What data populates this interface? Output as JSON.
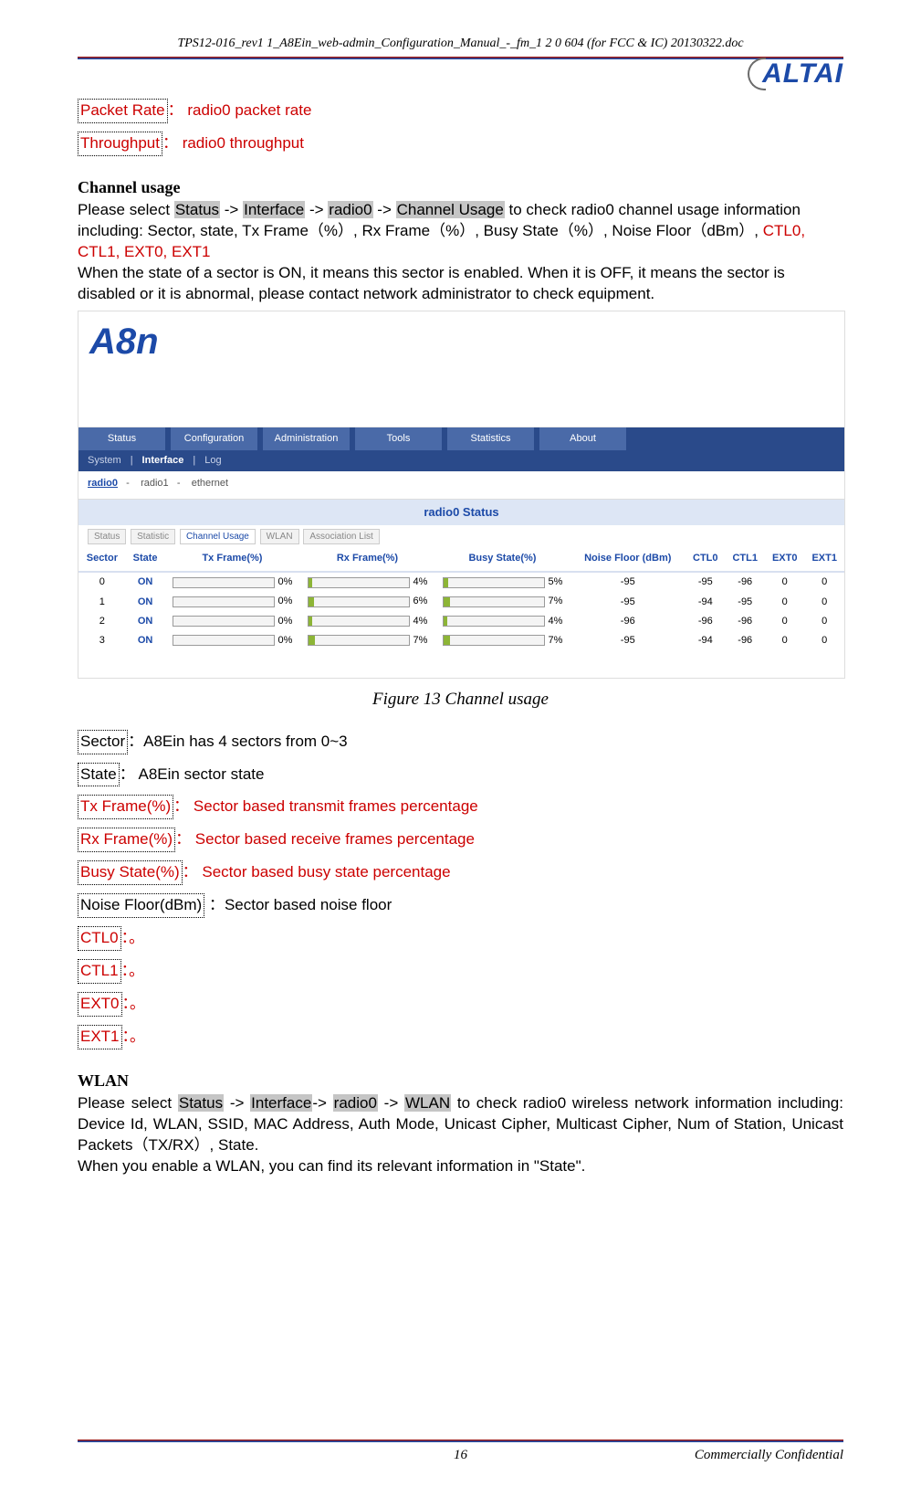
{
  "doc_header": "TPS12-016_rev1 1_A8Ein_web-admin_Configuration_Manual_-_fm_1 2 0 604 (for FCC & IC) 20130322.doc",
  "logo_text": "ALTAI",
  "top_defs": {
    "packet_rate_label": "Packet Rate",
    "packet_rate_desc": "radio0 packet rate",
    "throughput_label": "Throughput",
    "throughput_desc": "radio0 throughput"
  },
  "channel_usage": {
    "heading": "Channel usage",
    "p1_pre": "Please select ",
    "nav_status": "Status",
    "arrow": " -> ",
    "nav_interface": "Interface",
    "nav_radio0": "radio0",
    "nav_channel_usage": "Channel Usage",
    "p1_post": " to check radio0 channel usage information including: Sector, state, Tx Frame（%）, Rx Frame（%）, Busy State（%）, Noise Floor（dBm）, ",
    "p1_red": "CTL0, CTL1, EXT0, EXT1",
    "p2": "When the state of a sector is ON, it means this sector is enabled. When it is OFF, it means the sector is disabled or it is abnormal, please contact network administrator to check equipment."
  },
  "screenshot": {
    "brand": "A8n",
    "nav": [
      "Status",
      "Configuration",
      "Administration",
      "Tools",
      "Statistics",
      "About"
    ],
    "subnav": {
      "system": "System",
      "interface": "Interface",
      "log": "Log"
    },
    "iface": {
      "radio0": "radio0",
      "radio1": "radio1",
      "ethernet": "ethernet"
    },
    "title": "radio0 Status",
    "tabs": [
      "Status",
      "Statistic",
      "Channel Usage",
      "WLAN",
      "Association List"
    ],
    "headers": [
      "Sector",
      "State",
      "Tx Frame(%)",
      "Rx Frame(%)",
      "Busy State(%)",
      "Noise Floor (dBm)",
      "CTL0",
      "CTL1",
      "EXT0",
      "EXT1"
    ],
    "rows": [
      {
        "sector": "0",
        "state": "ON",
        "tx": "0%",
        "txv": 0,
        "rx": "4%",
        "rxv": 4,
        "busy": "5%",
        "busyv": 5,
        "nf": "-95",
        "c0": "-95",
        "c1": "-96",
        "e0": "0",
        "e1": "0"
      },
      {
        "sector": "1",
        "state": "ON",
        "tx": "0%",
        "txv": 0,
        "rx": "6%",
        "rxv": 6,
        "busy": "7%",
        "busyv": 7,
        "nf": "-95",
        "c0": "-94",
        "c1": "-95",
        "e0": "0",
        "e1": "0"
      },
      {
        "sector": "2",
        "state": "ON",
        "tx": "0%",
        "txv": 0,
        "rx": "4%",
        "rxv": 4,
        "busy": "4%",
        "busyv": 4,
        "nf": "-96",
        "c0": "-96",
        "c1": "-96",
        "e0": "0",
        "e1": "0"
      },
      {
        "sector": "3",
        "state": "ON",
        "tx": "0%",
        "txv": 0,
        "rx": "7%",
        "rxv": 7,
        "busy": "7%",
        "busyv": 7,
        "nf": "-95",
        "c0": "-94",
        "c1": "-96",
        "e0": "0",
        "e1": "0"
      }
    ]
  },
  "figure_caption": "Figure 13 Channel usage",
  "defs": {
    "sector_label": "Sector",
    "sector_desc": "A8Ein has 4 sectors from 0~3",
    "state_label": "State",
    "state_desc": " A8Ein sector state",
    "tx_label": "Tx Frame(%)",
    "tx_desc": " Sector based transmit frames percentage",
    "rx_label": "Rx Frame(%)",
    "rx_desc": " Sector based receive frames percentage",
    "busy_label": "Busy State(%)",
    "busy_desc": " Sector based busy state percentage",
    "nf_label": "Noise Floor(dBm)",
    "nf_desc": "Sector based noise floor",
    "ctl0_label": "CTL0",
    "ctl1_label": "CTL1",
    "ext0_label": "EXT0",
    "ext1_label": "EXT1",
    "dot": "。"
  },
  "wlan": {
    "heading": "WLAN",
    "p1_pre": "Please  select  ",
    "nav_status": "Status",
    "arrow": "  ->  ",
    "nav_interface": "Interface",
    "nav_radio0": "radio0",
    "nav_wlan": "WLAN",
    "p1_post": "  to  check  radio0  wireless  network  information including: Device Id, WLAN, SSID, MAC Address, Auth Mode, Unicast Cipher, Multicast Cipher, Num of Station, Unicast Packets（TX/RX）, State.",
    "p2": "When you enable a WLAN, you can find its relevant information in \"State\"."
  },
  "footer": {
    "page": "16",
    "conf": "Commercially Confidential"
  },
  "chart_data": {
    "type": "table",
    "title": "radio0 Status — Channel Usage",
    "columns": [
      "Sector",
      "State",
      "Tx Frame(%)",
      "Rx Frame(%)",
      "Busy State(%)",
      "Noise Floor (dBm)",
      "CTL0",
      "CTL1",
      "EXT0",
      "EXT1"
    ],
    "rows": [
      [
        0,
        "ON",
        0,
        4,
        5,
        -95,
        -95,
        -96,
        0,
        0
      ],
      [
        1,
        "ON",
        0,
        6,
        7,
        -95,
        -94,
        -95,
        0,
        0
      ],
      [
        2,
        "ON",
        0,
        4,
        4,
        -96,
        -96,
        -96,
        0,
        0
      ],
      [
        3,
        "ON",
        0,
        7,
        7,
        -95,
        -94,
        -96,
        0,
        0
      ]
    ]
  }
}
